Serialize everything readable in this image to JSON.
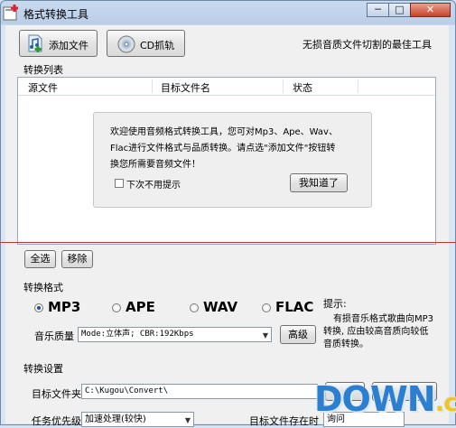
{
  "window": {
    "title": "格式转换工具",
    "controls": [
      "─",
      "□",
      "✕"
    ]
  },
  "toolbar": {
    "add_files_label": "添加文件",
    "cd_rip_label": "CD抓轨",
    "slogan": "无损音质文件切割的最佳工具"
  },
  "list": {
    "section_title": "转换列表",
    "columns": [
      "源文件",
      "目标文件名",
      "状态"
    ]
  },
  "welcome_dialog": {
    "message_line1": "欢迎使用音频格式转换工具，您可对Mp3、Ape、Wav、",
    "message_line2": "Flac进行文件格式与品质转换。请点选\"添加文件\"按钮转",
    "message_line3": "换您所需要音频文件！",
    "dont_show_label": "下次不用提示",
    "dont_show_checked": false,
    "ok_label": "我知道了"
  },
  "list_actions": {
    "select_all_label": "全选",
    "remove_label": "移除"
  },
  "format": {
    "section_title": "转换格式",
    "options": [
      "MP3",
      "APE",
      "WAV",
      "FLAC"
    ],
    "selected": "MP3",
    "tip_title": "提示:",
    "tip_line1": "有损音乐格式歌曲向MP3",
    "tip_line2": "转换, 应由较高音质向较低",
    "tip_line3": "音质转换。",
    "quality_label": "音乐质量",
    "quality_value": "Mode:立体声; CBR:192Kbps",
    "advanced_label": "高级"
  },
  "settings": {
    "section_title": "转换设置",
    "target_folder_label": "目标文件夹",
    "target_folder_value": "C:\\Kugou\\Convert\\",
    "priority_label": "任务优先级",
    "priority_value": "加速处理(较快)",
    "exists_label": "目标文件存在时",
    "exists_value": "询问"
  },
  "watermark": {
    "main": "DOWN",
    "suffix": ".cc"
  },
  "colors": {
    "selected_radio": "#1a4e9a",
    "divider": "#b33a3a",
    "watermark": "#2a7fd1",
    "watermark_suffix": "#f1c42b"
  }
}
